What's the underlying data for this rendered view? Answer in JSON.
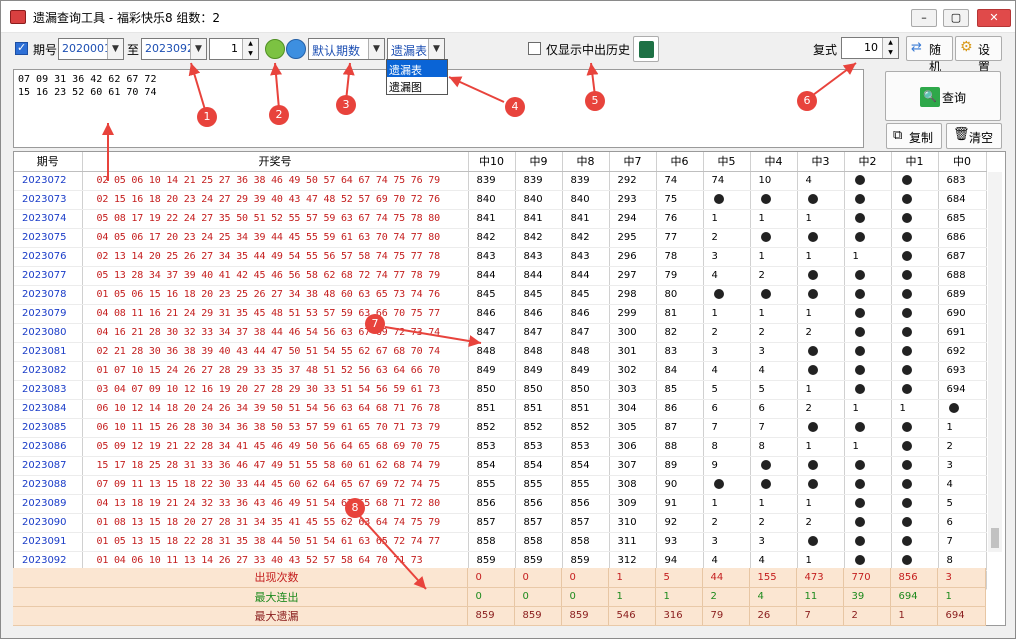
{
  "window": {
    "title": "遗漏查询工具 - 福彩快乐8 组数：2",
    "min": "–",
    "max": "▢",
    "close": "✕"
  },
  "toolbar": {
    "issue_label": "期号",
    "from_issue": "2020001",
    "to_label": "至",
    "to_issue": "2023092",
    "spin_value": "1",
    "period_select": "默认期数",
    "view_select": "遗漏表",
    "show_history_label": "仅显示中出历史",
    "fushi_label": "复式",
    "fushi_value": "10",
    "random_label": "随机",
    "settings_label": "设置",
    "query_label": "查询",
    "copy_label": "复制",
    "clear_label": "清空"
  },
  "dropdown_options": [
    "遗漏表",
    "遗漏图"
  ],
  "input_text": "07 09 31 36 42 62 67 72\n15 16 23 52 60 61 70 74",
  "columns": [
    "期号",
    "开奖号",
    "中10",
    "中9",
    "中8",
    "中7",
    "中6",
    "中5",
    "中4",
    "中3",
    "中2",
    "中1",
    "中0"
  ],
  "rows": [
    {
      "issue": "2023072",
      "nums": "02 05 06 10 14 21 25 27 36 38 46 49 50 57 64 67 74 75 76 79",
      "v": [
        "839",
        "839",
        "839",
        "292",
        "74",
        "74",
        "10",
        "4",
        "●",
        "●",
        "683"
      ]
    },
    {
      "issue": "2023073",
      "nums": "02 15 16 18 20 23 24 27 29 39 40 43 47 48 52 57 69 70 72 76",
      "v": [
        "840",
        "840",
        "840",
        "293",
        "75",
        "●",
        "●",
        "●",
        "●",
        "●",
        "684"
      ]
    },
    {
      "issue": "2023074",
      "nums": "05 08 17 19 22 24 27 35 50 51 52 55 57 59 63 67 74 75 78 80",
      "v": [
        "841",
        "841",
        "841",
        "294",
        "76",
        "1",
        "1",
        "1",
        "●",
        "●",
        "685"
      ]
    },
    {
      "issue": "2023075",
      "nums": "04 05 06 17 20 23 24 25 34 39 44 45 55 59 61 63 70 74 77 80",
      "v": [
        "842",
        "842",
        "842",
        "295",
        "77",
        "2",
        "●",
        "●",
        "●",
        "●",
        "686"
      ]
    },
    {
      "issue": "2023076",
      "nums": "02 13 14 20 25 26 27 34 35 44 49 54 55 56 57 58 74 75 77 78",
      "v": [
        "843",
        "843",
        "843",
        "296",
        "78",
        "3",
        "1",
        "1",
        "1",
        "●",
        "687"
      ]
    },
    {
      "issue": "2023077",
      "nums": "05 13 28 34 37 39 40 41 42 45 46 56 58 62 68 72 74 77 78 79",
      "v": [
        "844",
        "844",
        "844",
        "297",
        "79",
        "4",
        "2",
        "●",
        "●",
        "●",
        "688"
      ]
    },
    {
      "issue": "2023078",
      "nums": "01 05 06 15 16 18 20 23 25 26 27 34 38 48 60 63 65 73 74 76",
      "v": [
        "845",
        "845",
        "845",
        "298",
        "80",
        "●",
        "●",
        "●",
        "●",
        "●",
        "689"
      ]
    },
    {
      "issue": "2023079",
      "nums": "04 08 11 16 21 24 29 31 35 45 48 51 53 57 59 63 66 70 75 77",
      "v": [
        "846",
        "846",
        "846",
        "299",
        "81",
        "1",
        "1",
        "1",
        "●",
        "●",
        "690"
      ]
    },
    {
      "issue": "2023080",
      "nums": "04 16 21 28 30 32 33 34 37 38 44 46 54 56 63 67 69 72 73 74",
      "v": [
        "847",
        "847",
        "847",
        "300",
        "82",
        "2",
        "2",
        "2",
        "●",
        "●",
        "691"
      ]
    },
    {
      "issue": "2023081",
      "nums": "02 21 28 30 36 38 39 40 43 44 47 50 51 54 55 62 67 68 70 74",
      "v": [
        "848",
        "848",
        "848",
        "301",
        "83",
        "3",
        "3",
        "●",
        "●",
        "●",
        "692"
      ]
    },
    {
      "issue": "2023082",
      "nums": "01 07 10 15 24 26 27 28 29 33 35 37 48 51 52 56 63 64 66 70",
      "v": [
        "849",
        "849",
        "849",
        "302",
        "84",
        "4",
        "4",
        "●",
        "●",
        "●",
        "693"
      ]
    },
    {
      "issue": "2023083",
      "nums": "03 04 07 09 10 12 16 19 20 27 28 29 30 33 51 54 56 59 61 73",
      "v": [
        "850",
        "850",
        "850",
        "303",
        "85",
        "5",
        "5",
        "1",
        "●",
        "●",
        "694"
      ]
    },
    {
      "issue": "2023084",
      "nums": "06 10 12 14 18 20 24 26 34 39 50 51 54 56 63 64 68 71 76 78",
      "v": [
        "851",
        "851",
        "851",
        "304",
        "86",
        "6",
        "6",
        "2",
        "1",
        "1",
        "●"
      ]
    },
    {
      "issue": "2023085",
      "nums": "06 10 11 15 26 28 30 34 36 38 50 53 57 59 61 65 70 71 73 79",
      "v": [
        "852",
        "852",
        "852",
        "305",
        "87",
        "7",
        "7",
        "●",
        "●",
        "●",
        "1"
      ]
    },
    {
      "issue": "2023086",
      "nums": "05 09 12 19 21 22 28 34 41 45 46 49 50 56 64 65 68 69 70 75",
      "v": [
        "853",
        "853",
        "853",
        "306",
        "88",
        "8",
        "8",
        "1",
        "1",
        "●",
        "2"
      ]
    },
    {
      "issue": "2023087",
      "nums": "15 17 18 25 28 31 33 36 46 47 49 51 55 58 60 61 62 68 74 79",
      "v": [
        "854",
        "854",
        "854",
        "307",
        "89",
        "9",
        "●",
        "●",
        "●",
        "●",
        "3"
      ]
    },
    {
      "issue": "2023088",
      "nums": "07 09 11 13 15 18 22 30 33 44 45 60 62 64 65 67 69 72 74 75",
      "v": [
        "855",
        "855",
        "855",
        "308",
        "90",
        "●",
        "●",
        "●",
        "●",
        "●",
        "4"
      ]
    },
    {
      "issue": "2023089",
      "nums": "04 13 18 19 21 24 32 33 36 43 46 49 51 54 63 65 68 71 72 80",
      "v": [
        "856",
        "856",
        "856",
        "309",
        "91",
        "1",
        "1",
        "1",
        "●",
        "●",
        "5"
      ]
    },
    {
      "issue": "2023090",
      "nums": "01 08 13 15 18 20 27 28 31 34 35 41 45 55 62 63 64 74 75 79",
      "v": [
        "857",
        "857",
        "857",
        "310",
        "92",
        "2",
        "2",
        "2",
        "●",
        "●",
        "6"
      ]
    },
    {
      "issue": "2023091",
      "nums": "01 05 13 15 18 22 28 31 35 38 44 50 51 54 61 63 65 72 74 77",
      "v": [
        "858",
        "858",
        "858",
        "311",
        "93",
        "3",
        "3",
        "●",
        "●",
        "●",
        "7"
      ]
    },
    {
      "issue": "2023092",
      "nums": "01 04 06 10 11 13 14 26 27 33 40 43 52 57 58 64 70 71 73",
      "v": [
        "859",
        "859",
        "859",
        "312",
        "94",
        "4",
        "4",
        "1",
        "●",
        "●",
        "8"
      ]
    }
  ],
  "summary": [
    {
      "label": "出现次数",
      "color": "#c41e1e",
      "v": [
        "0",
        "0",
        "0",
        "1",
        "5",
        "44",
        "155",
        "473",
        "770",
        "856",
        "3"
      ]
    },
    {
      "label": "最大连出",
      "color": "#1d8a1d",
      "v": [
        "0",
        "0",
        "0",
        "1",
        "1",
        "2",
        "4",
        "11",
        "39",
        "694",
        "1"
      ]
    },
    {
      "label": "最大遗漏",
      "color": "#8a1d1d",
      "v": [
        "859",
        "859",
        "859",
        "546",
        "316",
        "79",
        "26",
        "7",
        "2",
        "1",
        "694"
      ]
    }
  ],
  "annotations": [
    "1",
    "2",
    "3",
    "4",
    "5",
    "6",
    "7",
    "8"
  ]
}
